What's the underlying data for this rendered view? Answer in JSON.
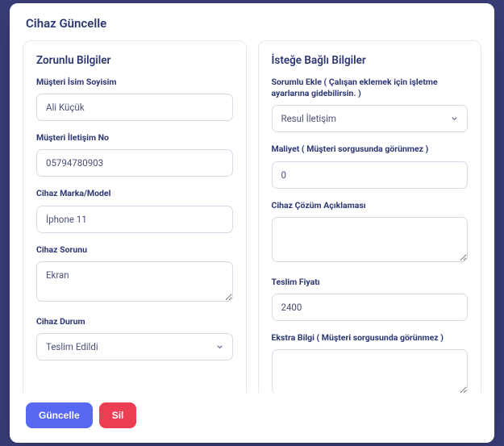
{
  "modal": {
    "title": "Cihaz Güncelle"
  },
  "leftCard": {
    "title": "Zorunlu Bilgiler",
    "customerName": {
      "label": "Müşteri İsim Soyisim",
      "value": "Ali Küçük"
    },
    "customerContact": {
      "label": "Müşteri İletişim No",
      "value": "05794780903"
    },
    "brandModel": {
      "label": "Cihaz Marka/Model",
      "value": "İphone 11"
    },
    "problem": {
      "label": "Cihaz Sorunu",
      "value": "Ekran"
    },
    "status": {
      "label": "Cihaz Durum",
      "value": "Teslim Edildi"
    }
  },
  "rightCard": {
    "title": "İsteğe Bağlı Bilgiler",
    "assignee": {
      "label": "Sorumlu Ekle ( Çalışan eklemek için işletme ayarlarına gidebilirsin. )",
      "value": "Resul İletişim"
    },
    "cost": {
      "label": "Maliyet ( Müşteri sorgusunda görünmez )",
      "value": "0"
    },
    "solution": {
      "label": "Cihaz Çözüm Açıklaması",
      "value": ""
    },
    "deliveryPrice": {
      "label": "Teslim Fiyatı",
      "value": "2400"
    },
    "extra": {
      "label": "Ekstra Bilgi ( Müşteri sorgusunda görünmez )",
      "value": ""
    }
  },
  "footer": {
    "update": "Güncelle",
    "delete": "Sil"
  }
}
